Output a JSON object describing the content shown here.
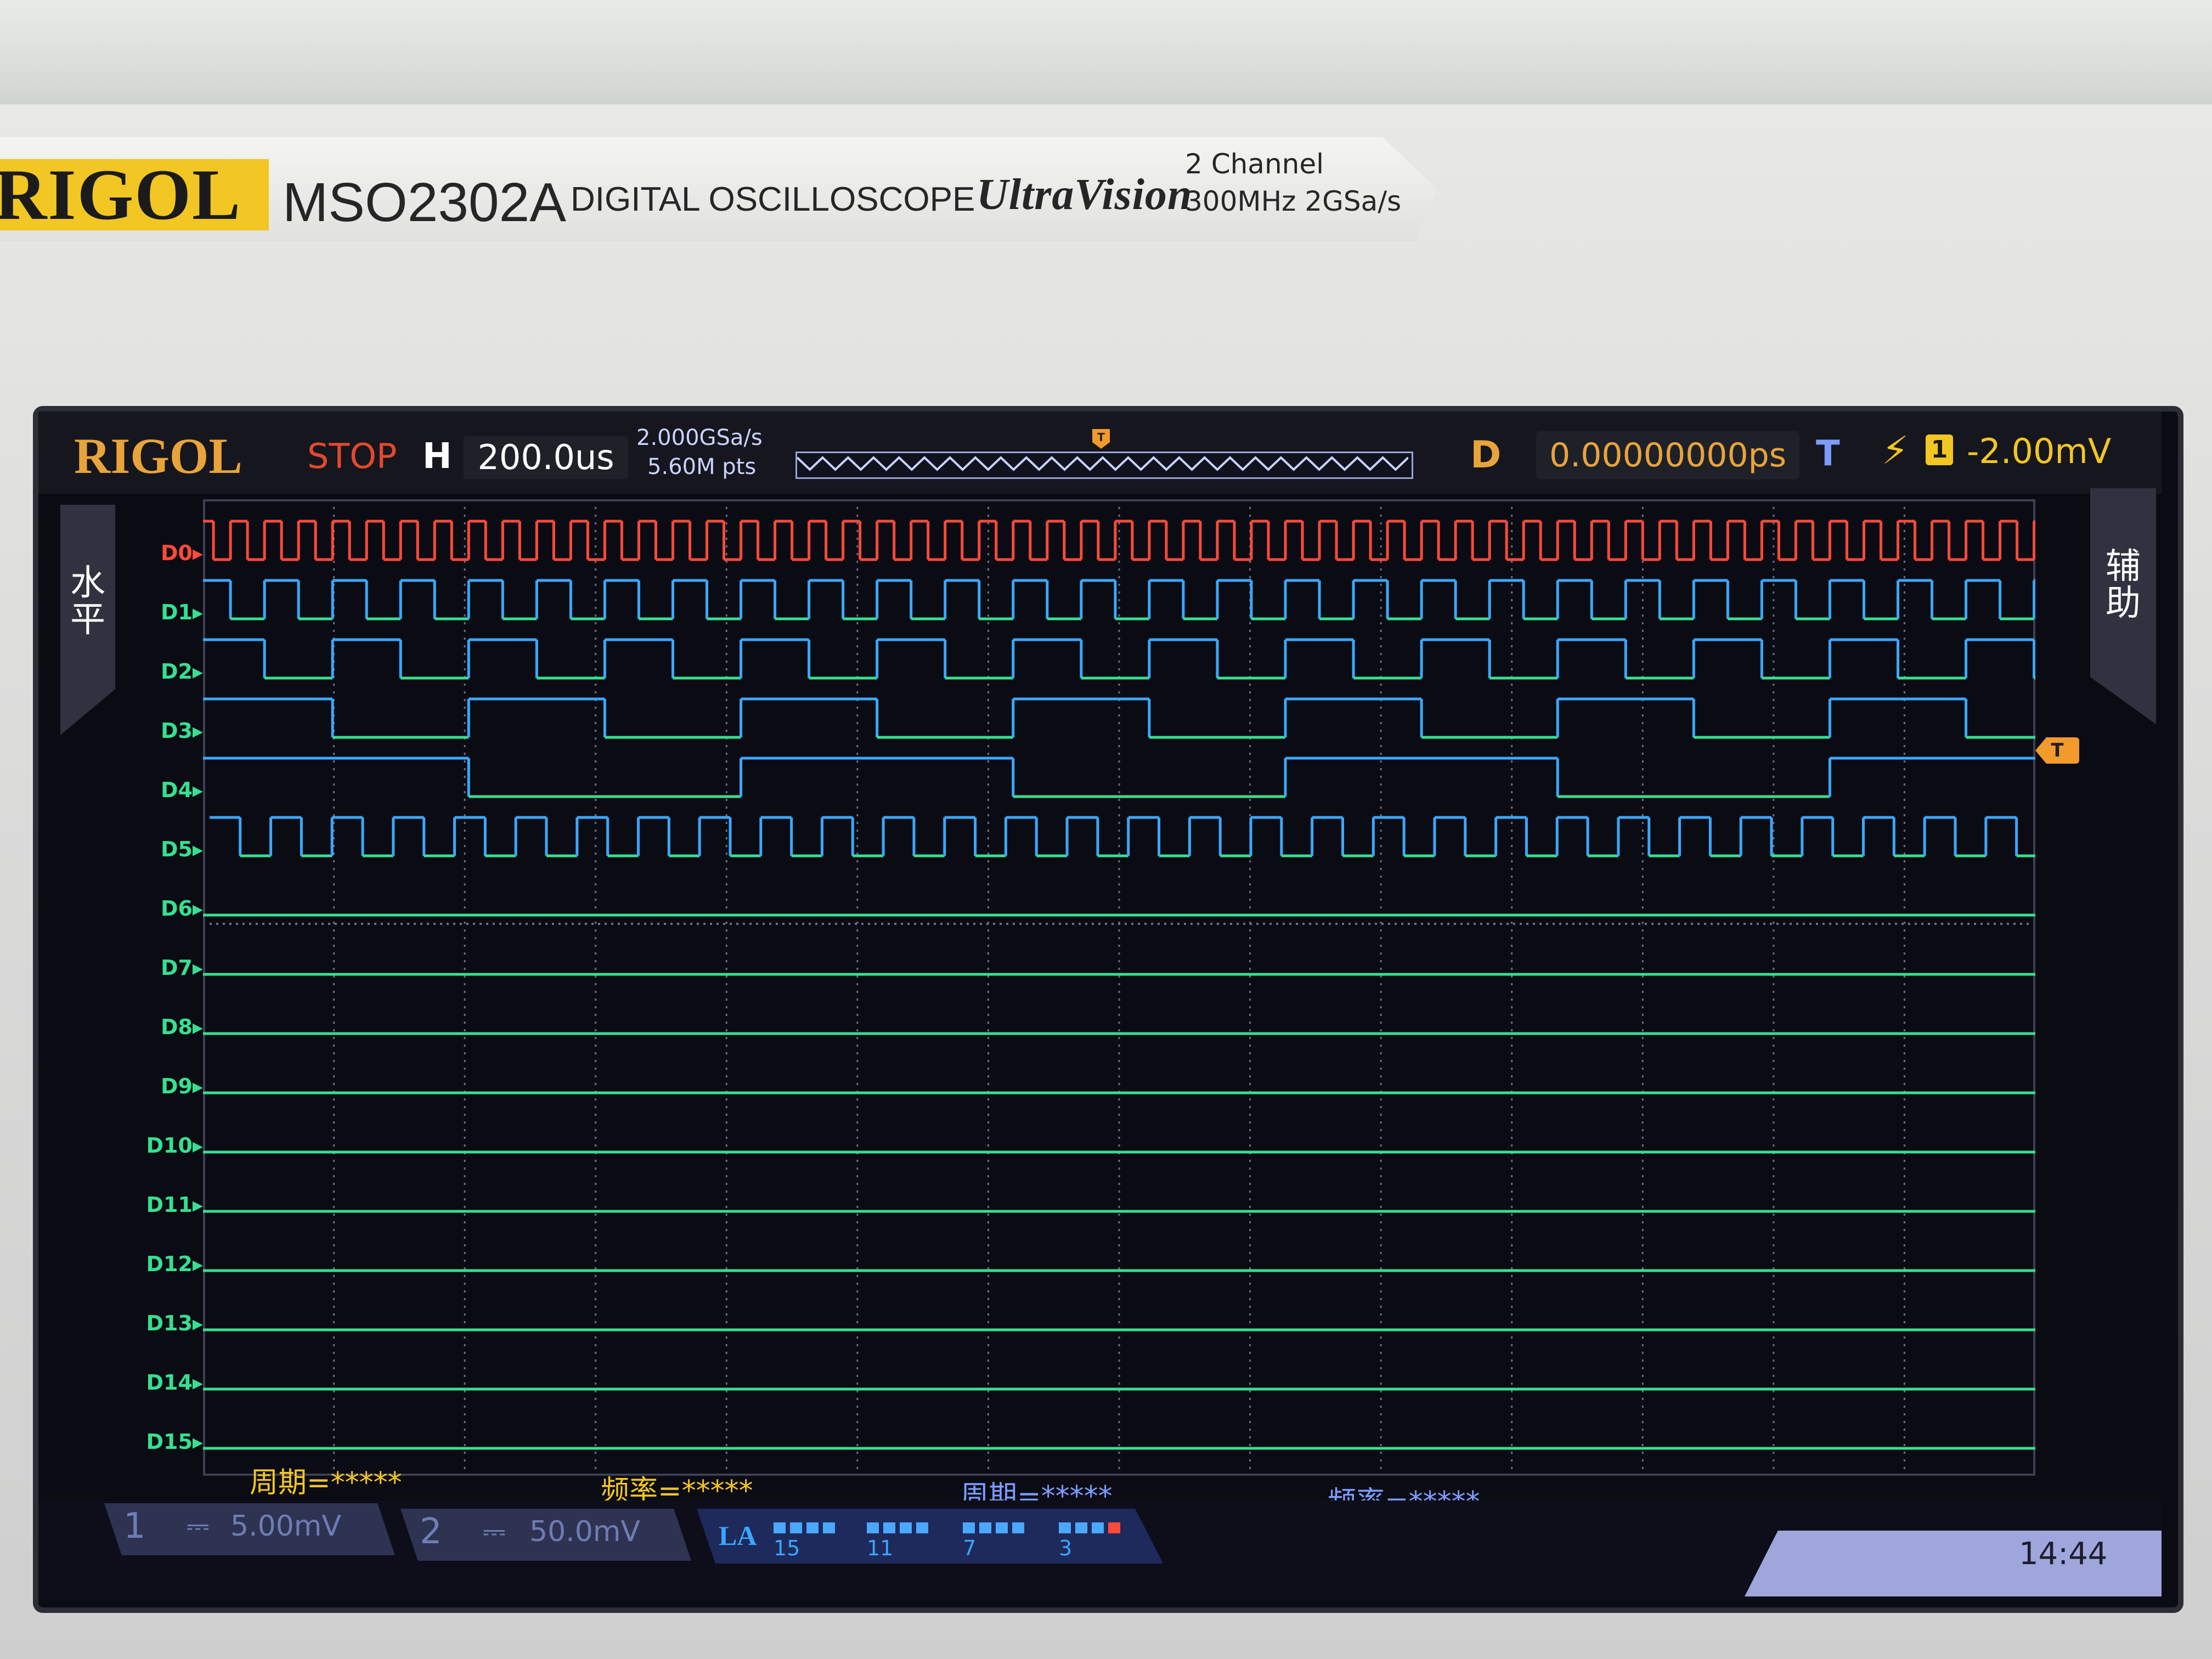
{
  "instrument": {
    "brand": "RIGOL",
    "model": "MSO2302A",
    "description": "DIGITAL OSCILLOSCOPE",
    "series_logo": "UltraVision",
    "spec_channels": "2 Channel",
    "spec_bandwidth_rate": "300MHz  2GSa/s"
  },
  "top_bar": {
    "logo": "RIGOL",
    "run_status": "STOP",
    "horizontal_label": "H",
    "timebase": "200.0us",
    "sample_rate": "2.000GSa/s",
    "memory_depth": "5.60M pts",
    "delay_label": "D",
    "delay_value": "0.00000000ps",
    "trigger_label": "T",
    "trigger_edge_icon": "rising-edge-icon",
    "trigger_source": "1",
    "trigger_level": "-2.00mV"
  },
  "side_menus": {
    "left": "水平",
    "right": "辅助"
  },
  "channels": [
    "D0",
    "D1",
    "D2",
    "D3",
    "D4",
    "D5",
    "D6",
    "D7",
    "D8",
    "D9",
    "D10",
    "D11",
    "D12",
    "D13",
    "D14",
    "D15"
  ],
  "colors": {
    "d0": "#ff4a3a",
    "high": "#3aa8ff",
    "low": "#35e08f",
    "grid": "#6a6f86",
    "accent": "#f2c623",
    "trigger": "#f29a2b"
  },
  "waveforms": {
    "D0_period_div": 0.26,
    "D1_period_div": 0.52,
    "D2_period_div": 1.04,
    "D3_period_div": 2.08,
    "D4_period_div": 4.16,
    "D6_to_D15_state": "low"
  },
  "measurements": [
    {
      "text": "周期=*****"
    },
    {
      "text": "频率=*****"
    },
    {
      "text": "周期=*****"
    },
    {
      "text": "频率=*****"
    }
  ],
  "bottom_bar": {
    "ch1_number": "1",
    "ch1_coupling_icon": "dc-coupling-icon",
    "ch1_scale": "5.00mV",
    "ch2_number": "2",
    "ch2_coupling_icon": "dc-coupling-icon",
    "ch2_scale": "50.0mV",
    "la_label": "LA",
    "la_groups": [
      "15",
      "11",
      "7",
      "3"
    ],
    "time": "14:44"
  }
}
